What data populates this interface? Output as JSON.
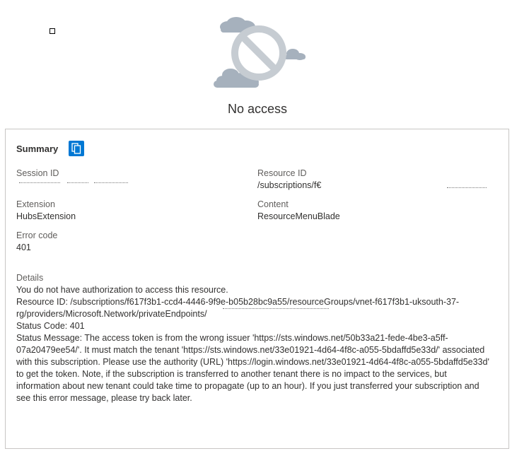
{
  "page": {
    "title": "No access"
  },
  "summary": {
    "heading": "Summary",
    "copy_icon": "copy-icon",
    "session_id_label": "Session ID",
    "resource_id_label": "Resource ID",
    "resource_id_value": "/subscriptions/f€",
    "extension_label": "Extension",
    "extension_value": "HubsExtension",
    "content_label": "Content",
    "content_value": "ResourceMenuBlade",
    "error_code_label": "Error code",
    "error_code_value": "401",
    "details_label": "Details",
    "details_text": "You do not have authorization to access this resource.",
    "resource_id_detail_line1": "Resource ID: /subscriptions/f617f3b1-ccd4-4446-9f9e-b05b28bc9a55/resourceGroups/vnet-f617f3b1-uksouth-37-",
    "resource_id_detail_line2": "rg/providers/Microsoft.Network/privateEndpoints/",
    "status_code_text": "Status Code: 401",
    "status_message_text": "Status Message: The access token is from the wrong issuer 'https://sts.windows.net/50b33a21-fede-4be3-a5ff-07a20479ee54/'. It must match the tenant 'https://sts.windows.net/33e01921-4d64-4f8c-a055-5bdaffd5e33d/' associated with this subscription. Please use the authority (URL) 'https://login.windows.net/33e01921-4d64-4f8c-a055-5bdaffd5e33d' to get the token. Note, if the subscription is transferred to another tenant there is no impact to the services, but information about new tenant could take time to propagate (up to an hour). If you just transferred your subscription and see this error message, please try back later."
  },
  "icons": {
    "illustration": "no-access-icon",
    "accent_color": "#0078d4",
    "illustration_color": "#a6b1bd"
  }
}
